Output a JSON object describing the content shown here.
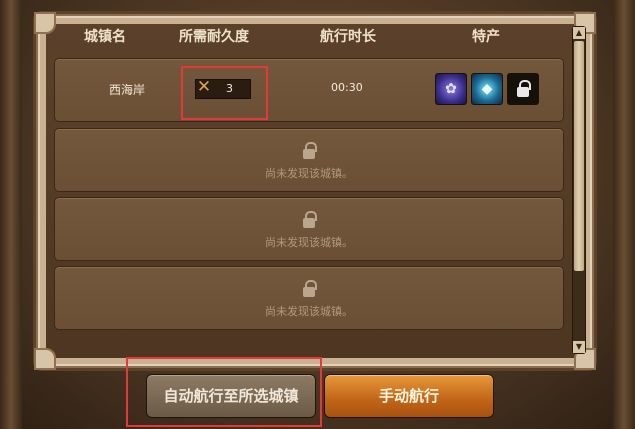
{
  "table": {
    "headers": {
      "town": "城镇名",
      "durability": "所需耐久度",
      "sail_time": "航行时长",
      "specialty": "特产"
    },
    "rows": [
      {
        "town": "西海岸",
        "durability": "3",
        "sail_time": "00:30",
        "specialties": [
          "purple-flower-icon",
          "cyan-crystal-icon",
          "lock-icon"
        ]
      }
    ],
    "undiscovered_text": "尚未发现该城镇。"
  },
  "buttons": {
    "auto_sail": "自动航行至所选城镇",
    "manual_sail": "手动航行"
  },
  "colors": {
    "highlight": "#e03a3a",
    "manual_button": "#c06518"
  }
}
